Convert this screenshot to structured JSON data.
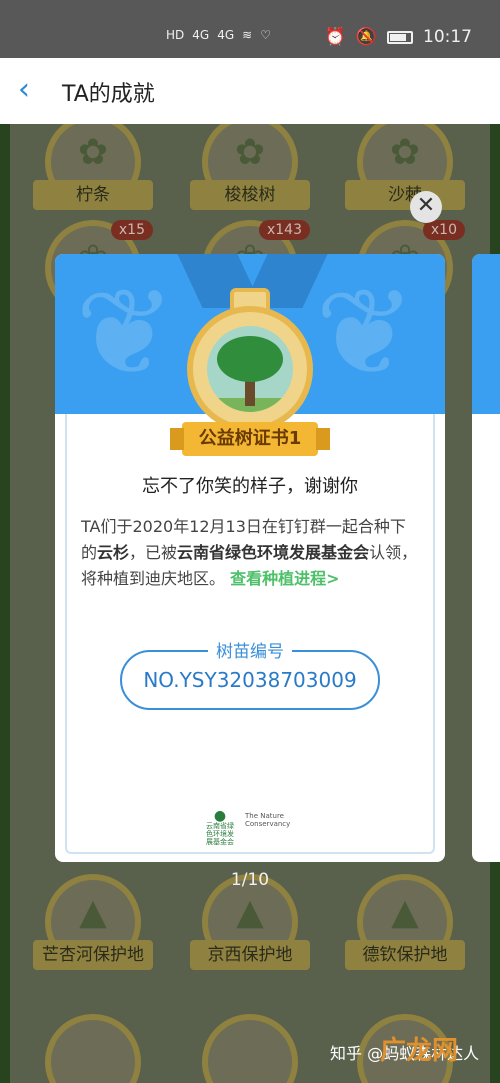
{
  "status_bar": {
    "net1": "HD",
    "net2": "4G",
    "net3": "4G",
    "time": "10:17"
  },
  "header": {
    "back_icon": "chevron-left-icon",
    "title": "TA的成就"
  },
  "background_badges": [
    {
      "label": "柠条",
      "count": ""
    },
    {
      "label": "梭梭树",
      "count": ""
    },
    {
      "label": "沙棘",
      "count": ""
    },
    {
      "label": "",
      "count": "x15"
    },
    {
      "label": "",
      "count": "x143"
    },
    {
      "label": "",
      "count": "x10"
    },
    {
      "label": "芒杏河保护地",
      "count": ""
    },
    {
      "label": "京西保护地",
      "count": ""
    },
    {
      "label": "德钦保护地",
      "count": ""
    }
  ],
  "certificate": {
    "ribbon": "公益树证书1",
    "message": "忘不了你笑的样子，谢谢你",
    "para_part1": "TA们于2020年12月13日在钉钉群一起合种下的",
    "para_species": "云杉",
    "para_part2": "，已被",
    "para_org": "云南省绿色环境发展基金会",
    "para_part3": "认领，将种植到迪庆地区。",
    "para_link": "查看种植进程>",
    "code_label": "树苗编号",
    "code_value": "NO.YSY32038703009",
    "logo1_text": "云南省绿色环境发展基金会",
    "logo2_text": "The Nature Conservancy"
  },
  "pager": "1/10",
  "watermark": "知乎 @蚂蚁森林达人",
  "watermark_brand": "广龙网"
}
